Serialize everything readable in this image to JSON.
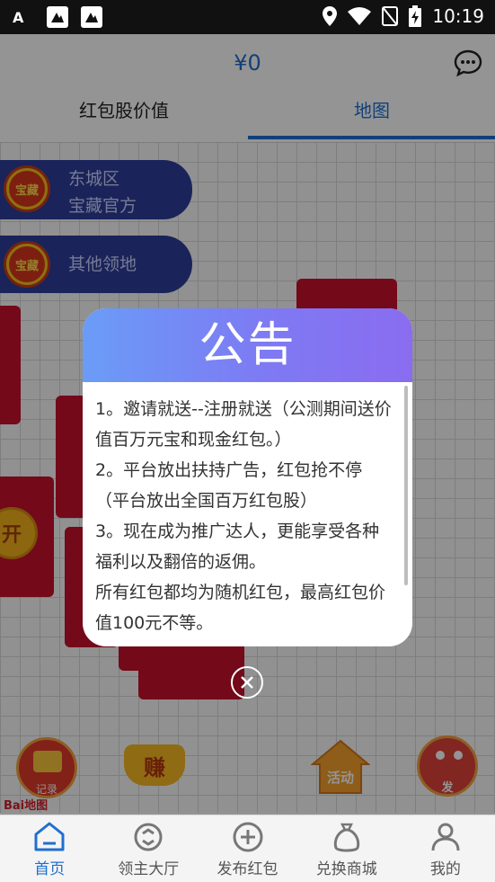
{
  "status_bar": {
    "time": "10:19",
    "left_icons": [
      "a-icon",
      "notification-image-icon",
      "notification-image-icon"
    ],
    "right_icons": [
      "location-icon",
      "wifi-icon",
      "no-sim-icon",
      "battery-charging-icon"
    ]
  },
  "header": {
    "balance": "¥0",
    "tabs": [
      {
        "label": "红包股价值",
        "active": false
      },
      {
        "label": "地图",
        "active": true
      }
    ],
    "accent_color": "#1f6fd0"
  },
  "map": {
    "territories": [
      {
        "badge": "宝藏",
        "line1": "东城区",
        "line2": "宝藏官方"
      },
      {
        "badge": "宝藏",
        "line1": "其他领地",
        "line2": ""
      }
    ],
    "envelope_coin_label": "开",
    "floating_buttons": [
      {
        "icon": "record-icon",
        "label": "记录"
      },
      {
        "icon": "earn-ingot-icon",
        "label": "赚"
      },
      {
        "icon": "activity-icon",
        "label": "活动"
      },
      {
        "icon": "send-mascot-icon",
        "label": "发"
      }
    ],
    "baidu_logo": "Bai地图"
  },
  "dialog": {
    "title": "公告",
    "lines": [
      "1。邀请就送--注册就送（公测期间送价值百万元宝和现金红包。）",
      "2。平台放出扶持广告，红包抢不停（平台放出全国百万红包股）",
      "3。现在成为推广达人，更能享受各种福利以及翻倍的返佣。",
      "所有红包都均为随机红包，最高红包价值100元不等。"
    ]
  },
  "bottom_nav": [
    {
      "label": "首页",
      "icon": "home-icon",
      "active": true
    },
    {
      "label": "领主大厅",
      "icon": "lord-hall-icon",
      "active": false
    },
    {
      "label": "发布红包",
      "icon": "publish-plus-icon",
      "active": false
    },
    {
      "label": "兑换商城",
      "icon": "exchange-bag-icon",
      "active": false
    },
    {
      "label": "我的",
      "icon": "profile-icon",
      "active": false
    }
  ]
}
